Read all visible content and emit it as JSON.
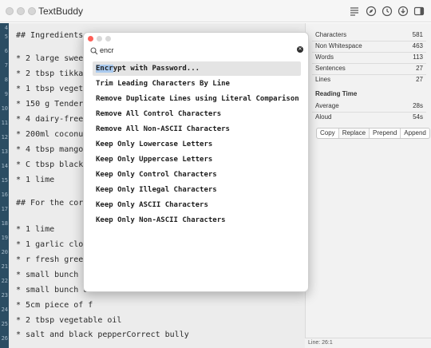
{
  "app": {
    "title": "TextBuddy"
  },
  "toolbar": {
    "icons": [
      "list-format-icon",
      "compass-icon",
      "clock-icon",
      "download-icon",
      "sidebar-toggle-icon"
    ]
  },
  "gutter": {
    "line_numbers": [
      "4",
      "5",
      "6",
      "7",
      "8",
      "9",
      "10",
      "11",
      "12",
      "13",
      "14",
      "15",
      "16",
      "17",
      "18",
      "19",
      "20",
      "21",
      "22",
      "23",
      "24",
      "25",
      "26"
    ]
  },
  "editor": {
    "lines": [
      "## Ingredients",
      "",
      "* 2 large sweet p",
      "* 2 tbsp tikka c",
      "* 1 tbsp vegetab",
      "* 150 g Tenderst",
      "* 4 dairy-free n",
      "* 200ml coconut",
      "* 4 tbsp mango c",
      "* C tbsp black o",
      "* 1 lime",
      "",
      "## For the corian",
      "",
      "* 1 lime",
      "* 1 garlic clove",
      "* r fresh green",
      "* small bunch of",
      "* small bunch of",
      "* 5cm piece of f",
      "* 2 tbsp vegetable oil",
      "* salt and black pepperCorrect bully"
    ]
  },
  "stats": {
    "rows": [
      {
        "label": "Characters",
        "value": "581"
      },
      {
        "label": "Non Whitespace",
        "value": "463"
      },
      {
        "label": "Words",
        "value": "113"
      },
      {
        "label": "Sentences",
        "value": "27"
      },
      {
        "label": "Lines",
        "value": "27"
      }
    ],
    "reading_time": {
      "title": "Reading Time",
      "rows": [
        {
          "label": "Average",
          "value": "28s"
        },
        {
          "label": "Aloud",
          "value": "54s"
        }
      ]
    },
    "buttons": [
      "Copy",
      "Replace",
      "Prepend",
      "Append"
    ]
  },
  "status": {
    "text": "Line: 26:1"
  },
  "popup": {
    "search": {
      "value": "encr",
      "placeholder": ""
    },
    "items": [
      {
        "label_highlight": "Encr",
        "label_rest": "ypt with Password..."
      },
      {
        "label": "Trim Leading Characters By Line"
      },
      {
        "label": "Remove Duplicate Lines using Literal Comparison"
      },
      {
        "label": "Remove All Control Characters"
      },
      {
        "label": "Remove All Non-ASCII Characters"
      },
      {
        "label": "Keep Only Lowercase Letters"
      },
      {
        "label": "Keep Only Uppercase Letters"
      },
      {
        "label": "Keep Only Control Characters"
      },
      {
        "label": "Keep Only Illegal Characters"
      },
      {
        "label": "Keep Only ASCII Characters"
      },
      {
        "label": "Keep Only Non-ASCII Characters"
      }
    ]
  },
  "colors": {
    "gutter": "#2b4d63",
    "editor_bg": "#ececec",
    "selection_highlight": "#a9c9ee",
    "close_button": "#fe5f57"
  }
}
